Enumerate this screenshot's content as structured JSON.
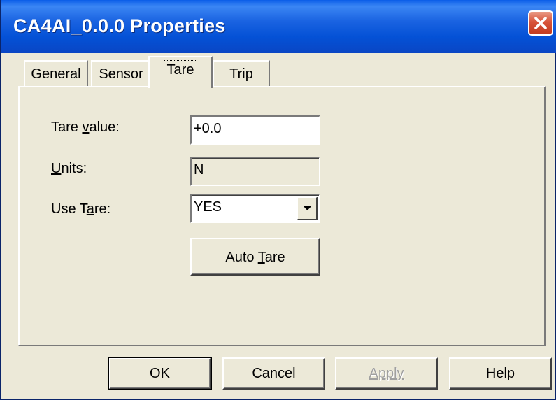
{
  "window": {
    "title": "CA4AI_0.0.0 Properties",
    "close_icon": "close-icon"
  },
  "tabs": [
    {
      "label": "General",
      "active": false
    },
    {
      "label": "Sensor",
      "active": false
    },
    {
      "label": "Tare",
      "active": true
    },
    {
      "label": "Trip",
      "active": false
    }
  ],
  "form": {
    "tare_value": {
      "label_pre": "Tare ",
      "label_key": "v",
      "label_post": "alue:",
      "value": "+0.0"
    },
    "units": {
      "label_key": "U",
      "label_post": "nits:",
      "value": "N"
    },
    "use_tare": {
      "label_pre": "Use T",
      "label_key": "a",
      "label_post": "re:",
      "value": "YES",
      "dropdown_icon": "chevron-down-icon"
    },
    "auto_tare": {
      "label_pre": "Auto ",
      "label_key": "T",
      "label_post": "are"
    }
  },
  "buttons": {
    "ok": "OK",
    "cancel": "Cancel",
    "apply": "Apply",
    "help": "Help"
  },
  "colors": {
    "titlebar": "#0451d6",
    "face": "#ece9d8",
    "close": "#d8543a"
  }
}
